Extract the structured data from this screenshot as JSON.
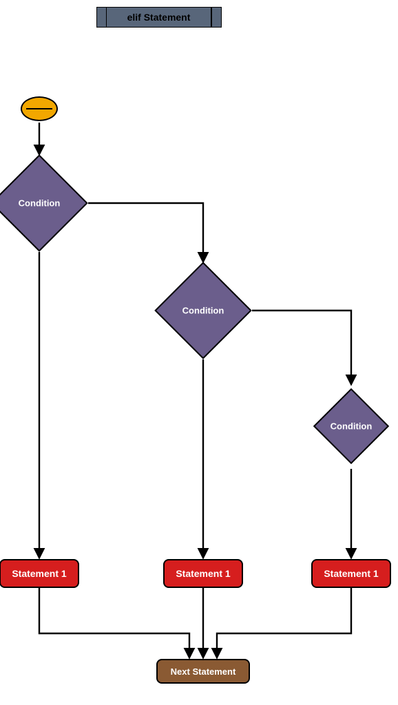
{
  "title": "elif Statement",
  "nodes": {
    "decision1": "Condition",
    "decision2": "Condition",
    "decision3": "Condition",
    "stmt1": "Statement 1",
    "stmt2": "Statement 1",
    "stmt3": "Statement 1",
    "next": "Next Statement"
  },
  "colors": {
    "titleFill": "#58667a",
    "startFill": "#f2a700",
    "decisionFill": "#6b5e8c",
    "statementFill": "#d61e1e",
    "nextFill": "#8a5a33",
    "stroke": "#000000"
  },
  "chart_data": {
    "type": "flowchart",
    "title": "elif Statement",
    "nodes": [
      {
        "id": "start",
        "kind": "start",
        "label": ""
      },
      {
        "id": "cond1",
        "kind": "decision",
        "label": "Condition"
      },
      {
        "id": "cond2",
        "kind": "decision",
        "label": "Condition"
      },
      {
        "id": "cond3",
        "kind": "decision",
        "label": "Condition"
      },
      {
        "id": "s1",
        "kind": "process",
        "label": "Statement 1"
      },
      {
        "id": "s2",
        "kind": "process",
        "label": "Statement 1"
      },
      {
        "id": "s3",
        "kind": "process",
        "label": "Statement 1"
      },
      {
        "id": "next",
        "kind": "terminator",
        "label": "Next Statement"
      }
    ],
    "edges": [
      {
        "from": "start",
        "to": "cond1"
      },
      {
        "from": "cond1",
        "to": "s1"
      },
      {
        "from": "cond1",
        "to": "cond2"
      },
      {
        "from": "cond2",
        "to": "s2"
      },
      {
        "from": "cond2",
        "to": "cond3"
      },
      {
        "from": "cond3",
        "to": "s3"
      },
      {
        "from": "s1",
        "to": "next"
      },
      {
        "from": "s2",
        "to": "next"
      },
      {
        "from": "s3",
        "to": "next"
      }
    ]
  }
}
